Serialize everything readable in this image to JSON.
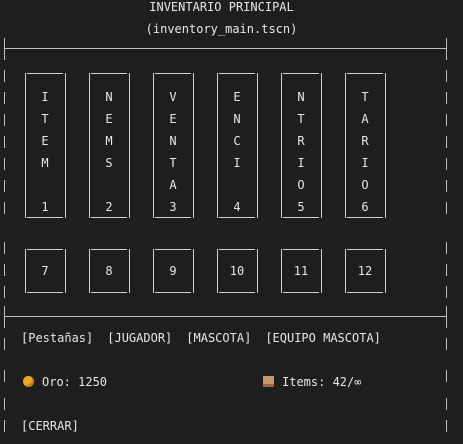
{
  "header": {
    "title": "INVENTARIO PRINCIPAL",
    "filename": "(inventory_main.tscn)"
  },
  "slots_row1": [
    {
      "letters": [
        "I",
        "T",
        "E",
        "M",
        "",
        "1"
      ]
    },
    {
      "letters": [
        "N",
        "E",
        "M",
        "S",
        "",
        "2"
      ]
    },
    {
      "letters": [
        "V",
        "E",
        "N",
        "T",
        "A",
        "3"
      ]
    },
    {
      "letters": [
        "E",
        "N",
        "C",
        "I",
        "",
        "4"
      ]
    },
    {
      "letters": [
        "N",
        "T",
        "R",
        "I",
        "O",
        "5"
      ]
    },
    {
      "letters": [
        "T",
        "A",
        "R",
        "I",
        "O",
        "6"
      ]
    }
  ],
  "slots_row2": [
    "7",
    "8",
    "9",
    "10",
    "11",
    "12"
  ],
  "tabs": [
    "[Pestañas]",
    "[JUGADOR]",
    "[MASCOTA]",
    "[EQUIPO MASCOTA]"
  ],
  "stats": {
    "gold_label": "Oro: 1250",
    "items_label": "Items: 42/∞",
    "gold_icon": "coin-icon",
    "items_icon": "box-icon"
  },
  "close_button": "[CERRAR]",
  "colors": {
    "background": "#1e1e1e",
    "text": "#e6e6e6",
    "coin": "#f0a81e",
    "box": "#c8946a"
  }
}
